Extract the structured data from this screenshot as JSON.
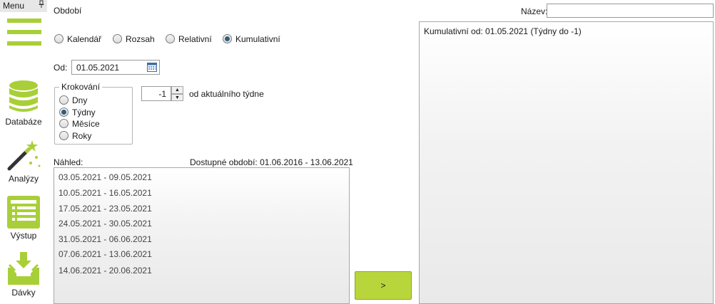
{
  "sidebar": {
    "menu_label": "Menu",
    "pin_glyph": "📌",
    "items": [
      {
        "label": "Databáze",
        "icon": "database-icon"
      },
      {
        "label": "Analýzy",
        "icon": "magic-wand-icon"
      },
      {
        "label": "Výstup",
        "icon": "report-icon"
      },
      {
        "label": "Dávky",
        "icon": "batch-import-icon"
      }
    ],
    "accent_color": "#a9cf38"
  },
  "period": {
    "title": "Období",
    "modes": [
      {
        "label": "Kalendář",
        "checked": false
      },
      {
        "label": "Rozsah",
        "checked": false
      },
      {
        "label": "Relativní",
        "checked": false
      },
      {
        "label": "Kumulativní",
        "checked": true
      }
    ],
    "from_label": "Od:",
    "from_value": "01.05.2021",
    "stepping": {
      "legend": "Krokování",
      "options": [
        {
          "label": "Dny",
          "checked": false
        },
        {
          "label": "Týdny",
          "checked": true
        },
        {
          "label": "Měsíce",
          "checked": false
        },
        {
          "label": "Roky",
          "checked": false
        }
      ]
    },
    "offset_value": "-1",
    "offset_suffix": "od aktuálního týdne"
  },
  "preview": {
    "label": "Náhled:",
    "available_label": "Dostupné období: 01.06.2016 - 13.06.2021",
    "rows": [
      "03.05.2021 - 09.05.2021",
      "10.05.2021 - 16.05.2021",
      "17.05.2021 - 23.05.2021",
      "24.05.2021 - 30.05.2021",
      "31.05.2021 - 06.06.2021",
      "07.06.2021 - 13.06.2021",
      "14.06.2021 - 20.06.2021"
    ]
  },
  "add_button_label": ">",
  "result": {
    "name_label": "Název:",
    "name_value": "",
    "items": [
      "Kumulativní od: 01.05.2021 (Týdny do -1)"
    ]
  }
}
